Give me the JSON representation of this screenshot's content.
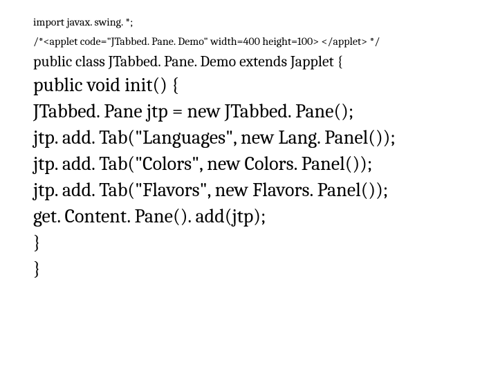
{
  "lines": [
    {
      "cls": "small",
      "text": "import javax. swing. *;"
    },
    {
      "cls": "small",
      "text": "/*<applet code=\"JTabbed. Pane. Demo\" width=400 height=100> </applet> */"
    },
    {
      "cls": "medium",
      "text": "public class JTabbed. Pane. Demo extends Japplet {"
    },
    {
      "cls": "large",
      "text": "public void init() {"
    },
    {
      "cls": "large",
      "text": "JTabbed. Pane jtp = new JTabbed. Pane();"
    },
    {
      "cls": "large",
      "text": "jtp. add. Tab(\"Languages\", new Lang. Panel());"
    },
    {
      "cls": "large",
      "text": "jtp. add. Tab(\"Colors\", new Colors. Panel());"
    },
    {
      "cls": "large",
      "text": "jtp. add. Tab(\"Flavors\", new Flavors. Panel());"
    },
    {
      "cls": "large",
      "text": "get. Content. Pane(). add(jtp);"
    },
    {
      "cls": "large",
      "text": "}"
    },
    {
      "cls": "large",
      "text": "}"
    }
  ]
}
